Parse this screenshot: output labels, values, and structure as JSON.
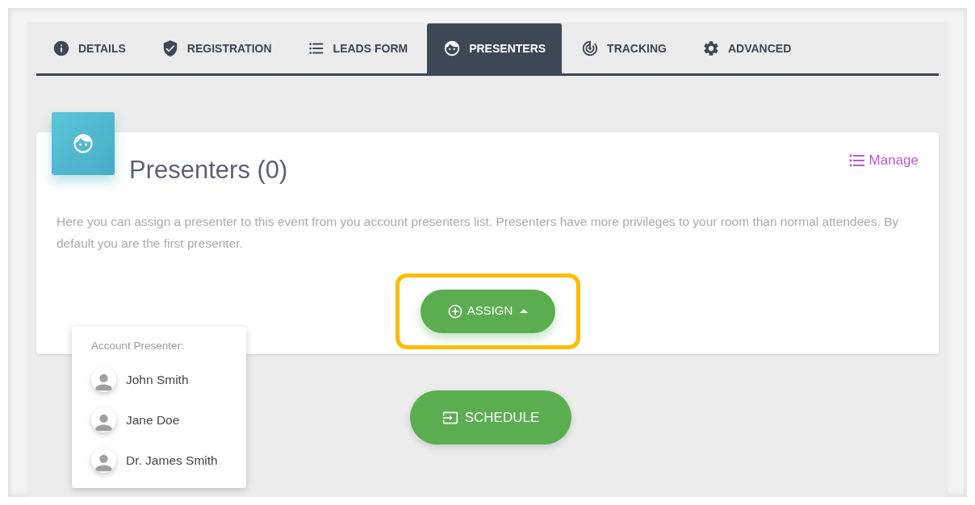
{
  "tabs": [
    {
      "label": "DETAILS",
      "selected": false
    },
    {
      "label": "REGISTRATION",
      "selected": false
    },
    {
      "label": "LEADS FORM",
      "selected": false
    },
    {
      "label": "PRESENTERS",
      "selected": true
    },
    {
      "label": "TRACKING",
      "selected": false
    },
    {
      "label": "ADVANCED",
      "selected": false
    }
  ],
  "card": {
    "title": "Presenters (0)",
    "manage_link": "Manage",
    "description": "Here you can assign a presenter to this event from you account presenters list. Presenters have more privileges to your room than normal attendees. By default you are the first presenter.",
    "assign_button": {
      "label": "ASSIGN",
      "expanded": true,
      "highlighted": true
    }
  },
  "dropdown": {
    "heading": "Account Presenter:",
    "items": [
      {
        "name": "John Smith"
      },
      {
        "name": "Jane Doe"
      },
      {
        "name": "Dr. James Smith"
      }
    ]
  },
  "schedule_button": {
    "label": "SCHEDULE"
  }
}
